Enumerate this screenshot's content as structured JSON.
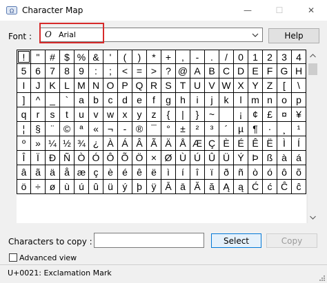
{
  "window": {
    "title": "Character Map",
    "minimize_glyph": "—",
    "maximize_glyph": "☐",
    "close_glyph": "✕"
  },
  "font": {
    "label": "Font :",
    "selected": "Arial",
    "type_glyph": "O"
  },
  "help_label": "Help",
  "characters": [
    [
      "!",
      "\"",
      "#",
      "$",
      "%",
      "&",
      "'",
      "(",
      ")",
      "*",
      "+",
      ",",
      "-",
      ".",
      "/",
      "0",
      "1",
      "2",
      "3",
      "4"
    ],
    [
      "5",
      "6",
      "7",
      "8",
      "9",
      ":",
      ";",
      "<",
      "=",
      ">",
      "?",
      "@",
      "A",
      "B",
      "C",
      "D",
      "E",
      "F",
      "G",
      "H"
    ],
    [
      "I",
      "J",
      "K",
      "L",
      "M",
      "N",
      "O",
      "P",
      "Q",
      "R",
      "S",
      "T",
      "U",
      "V",
      "W",
      "X",
      "Y",
      "Z",
      "[",
      "\\"
    ],
    [
      "]",
      "^",
      "_",
      "`",
      "a",
      "b",
      "c",
      "d",
      "e",
      "f",
      "g",
      "h",
      "i",
      "j",
      "k",
      "l",
      "m",
      "n",
      "o",
      "p"
    ],
    [
      "q",
      "r",
      "s",
      "t",
      "u",
      "v",
      "w",
      "x",
      "y",
      "z",
      "{",
      "|",
      "}",
      "~",
      " ",
      "¡",
      "¢",
      "£",
      "¤",
      "¥"
    ],
    [
      "¦",
      "§",
      "¨",
      "©",
      "ª",
      "«",
      "¬",
      "-",
      "®",
      "¯",
      "°",
      "±",
      "²",
      "³",
      "´",
      "µ",
      "¶",
      "·",
      "¸",
      "¹"
    ],
    [
      "º",
      "»",
      "¼",
      "½",
      "¾",
      "¿",
      "À",
      "Á",
      "Â",
      "Ã",
      "Ä",
      "Å",
      "Æ",
      "Ç",
      "È",
      "É",
      "Ê",
      "Ë",
      "Ì",
      "Í"
    ],
    [
      "Î",
      "Ï",
      "Ð",
      "Ñ",
      "Ò",
      "Ó",
      "Ô",
      "Õ",
      "Ö",
      "×",
      "Ø",
      "Ù",
      "Ú",
      "Û",
      "Ü",
      "Ý",
      "Þ",
      "ß",
      "à",
      "á"
    ],
    [
      "â",
      "ã",
      "ä",
      "å",
      "æ",
      "ç",
      "è",
      "é",
      "ê",
      "ë",
      "ì",
      "í",
      "î",
      "ï",
      "ð",
      "ñ",
      "ò",
      "ó",
      "ô",
      "õ"
    ],
    [
      "ö",
      "÷",
      "ø",
      "ù",
      "ú",
      "û",
      "ü",
      "ý",
      "þ",
      "ÿ",
      "Ā",
      "ā",
      "Ă",
      "ă",
      "Ą",
      "ą",
      "Ć",
      "ć",
      "Ĉ",
      "ĉ"
    ]
  ],
  "selected_char": "!",
  "copy": {
    "label": "Characters to copy :",
    "value": "",
    "select_label": "Select",
    "copy_label": "Copy"
  },
  "advanced": {
    "label": "Advanced view",
    "checked": false
  },
  "status": "U+0021: Exclamation Mark"
}
